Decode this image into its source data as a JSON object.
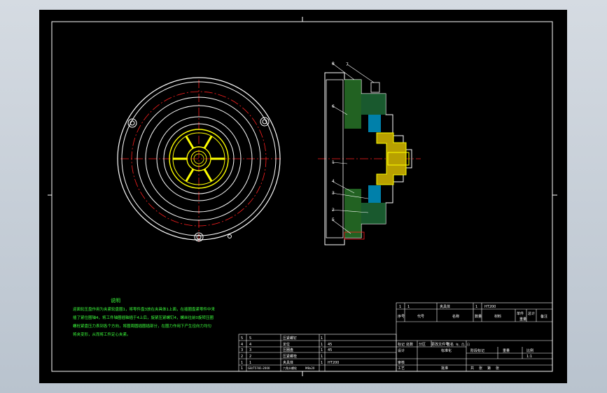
{
  "colors": {
    "background": "#000000",
    "frame": "#ffffff",
    "centerline": "#ff2020",
    "part_yellow": "#ffff00",
    "hatch_green": "#40c040",
    "hatch_cyan": "#00c8ff",
    "note_text": "#40ff40",
    "viewport_bg": "#c9d1da"
  },
  "notes": {
    "title": "说明",
    "lines": [
      "迎面轮压盘作用为夹紧轮盘圈1，将零件盘3放在夹具体1上面，在插圈盘紧零件中来",
      "插了紧住圈轴4，将工件轴圈插轴插于4上后，旋紧压紧螺钉4，螺丝往前0旋转压圈",
      "螺栓紧盘压力表到各个方向，将圈周圆插圈插部分，在圈力作用下产生径向力均匀",
      "将夹变形，从而将工件定心夹紧。"
    ]
  },
  "section_labels": [
    "8",
    "7",
    "6",
    "1",
    "4",
    "3",
    "2",
    "5"
  ],
  "bom": {
    "rows": [
      {
        "no": "5",
        "code": "5",
        "name": "压紧螺钉",
        "qty": "1",
        "material": ""
      },
      {
        "no": "4",
        "code": "4",
        "name": "定位",
        "qty": "1",
        "material": "45"
      },
      {
        "no": "3",
        "code": "3",
        "name": "压圈盘",
        "qty": "1",
        "material": "45"
      },
      {
        "no": "2",
        "code": "2",
        "name": "压紧螺栓",
        "qty": "1",
        "material": ""
      },
      {
        "no": "1",
        "code": "1",
        "name": "夹具体",
        "qty": "1",
        "material": "HT200"
      },
      {
        "no": "1",
        "code": "GB/T5781-2000",
        "name": "六角头螺栓",
        "qty": "M8x20",
        "material": ""
      }
    ]
  },
  "title_block": {
    "row_top": [
      "1",
      "1",
      "夹具体",
      "1",
      "HT200"
    ],
    "header": [
      "序号",
      "代号",
      "名称",
      "数量",
      "材料",
      "单件",
      "总计",
      "备注"
    ],
    "sub_header": [
      "重量"
    ],
    "labels": [
      "标记",
      "处数",
      "分区",
      "更改文件号",
      "签名",
      "年、月、日"
    ],
    "roles": [
      "设计",
      "标准化",
      "审核",
      "工艺",
      "批准"
    ],
    "stage": [
      "阶段标记",
      "重量",
      "比例"
    ],
    "sheet": [
      "共",
      "张",
      "第",
      "张"
    ],
    "scale": "1:1"
  }
}
